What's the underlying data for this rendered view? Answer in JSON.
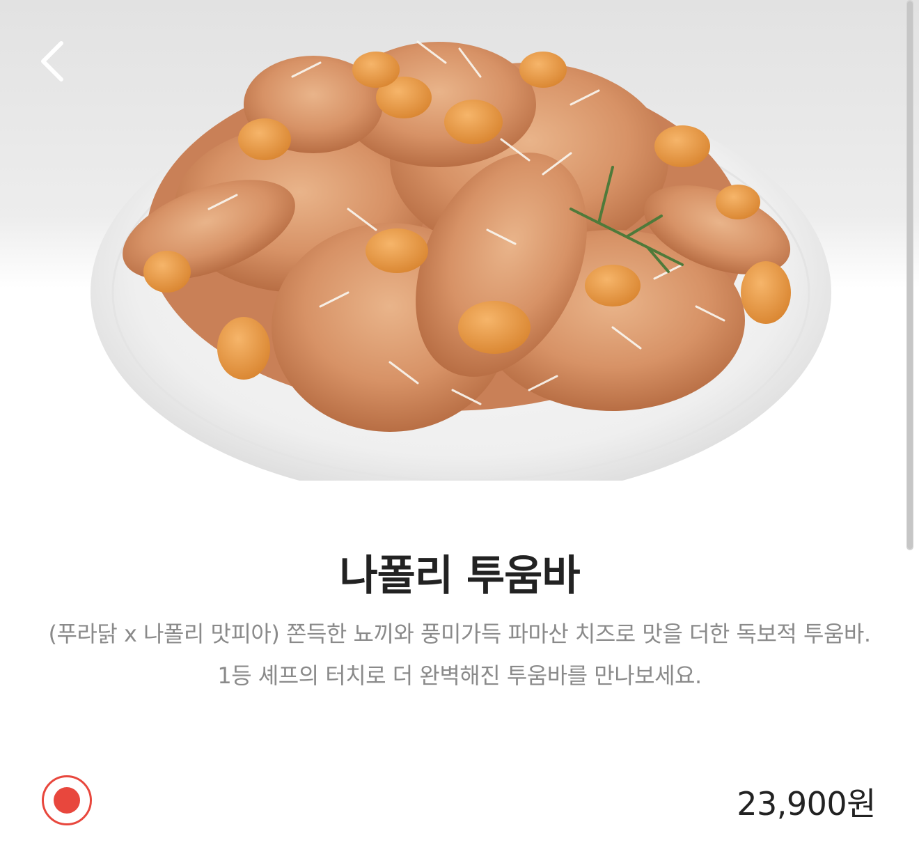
{
  "menu_item": {
    "name": "나폴리 투움바",
    "description": "(푸라닭 x 나폴리 맛피아) 쫀득한 뇨끼와 풍미가득 파마산 치즈로 맛을 더한 독보적 투움바. 1등 셰프의 터치로 더 완벽해진 투움바를 만나보세요.",
    "price": "23,900원",
    "option_selected": true
  },
  "icons": {
    "back": "chevron-left-icon",
    "selected": "radio-selected-icon"
  },
  "colors": {
    "accent": "#e8473d",
    "title": "#222222",
    "description": "#8a8a8a"
  }
}
